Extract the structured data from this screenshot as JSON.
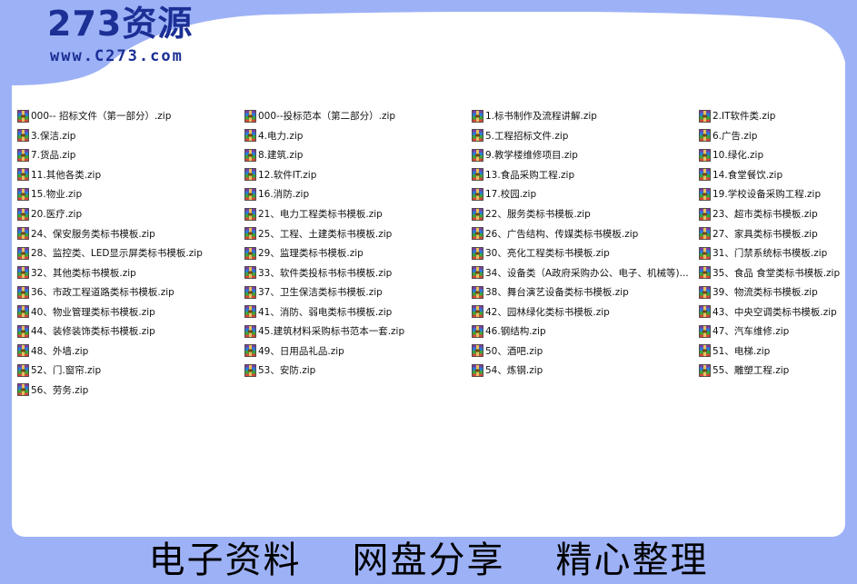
{
  "logo": {
    "title": "273资源",
    "url": "www.C273.com"
  },
  "icon_name": "winrar-archive-icon",
  "colors": {
    "background": "#9db1f6",
    "logo": "#1b2f95",
    "window": "#ffffff"
  },
  "files": [
    {
      "label": "000-- 招标文件（第一部分）.zip"
    },
    {
      "label": "000--投标范本（第二部分）.zip"
    },
    {
      "label": "1.标书制作及流程讲解.zip"
    },
    {
      "label": "2.IT软件类.zip"
    },
    {
      "label": "3.保洁.zip"
    },
    {
      "label": "4.电力.zip"
    },
    {
      "label": "5.工程招标文件.zip"
    },
    {
      "label": "6.广告.zip"
    },
    {
      "label": "7.货品.zip"
    },
    {
      "label": "8.建筑.zip"
    },
    {
      "label": "9.教学楼维修项目.zip"
    },
    {
      "label": "10.绿化.zip"
    },
    {
      "label": "11.其他各类.zip"
    },
    {
      "label": "12.软件IT.zip"
    },
    {
      "label": "13.食品采购工程.zip"
    },
    {
      "label": "14.食堂餐饮.zip"
    },
    {
      "label": "15.物业.zip"
    },
    {
      "label": "16.消防.zip"
    },
    {
      "label": "17.校园.zip"
    },
    {
      "label": "19.学校设备采购工程.zip"
    },
    {
      "label": "20.医疗.zip"
    },
    {
      "label": "21、电力工程类标书模板.zip"
    },
    {
      "label": "22、服务类标书模板.zip"
    },
    {
      "label": "23、超市类标书模板.zip"
    },
    {
      "label": "24、保安服务类标书模板.zip"
    },
    {
      "label": "25、工程、土建类标书模板.zip"
    },
    {
      "label": "26、广告结构、传媒类标书模板.zip"
    },
    {
      "label": "27、家具类标书模板.zip"
    },
    {
      "label": "28、监控类、LED显示屏类标书模板.zip"
    },
    {
      "label": "29、监理类标书模板.zip"
    },
    {
      "label": "30、亮化工程类标书模板.zip"
    },
    {
      "label": "31、门禁系统标书模板.zip"
    },
    {
      "label": "32、其他类标书模板.zip"
    },
    {
      "label": "33、软件类投标书标书模板.zip"
    },
    {
      "label": "34、设备类（A政府采购办公、电子、机械等)..."
    },
    {
      "label": "35、食品 食堂类标书模板.zip"
    },
    {
      "label": "36、市政工程道路类标书模板.zip"
    },
    {
      "label": "37、卫生保洁类标书模板.zip"
    },
    {
      "label": "38、舞台演艺设备类标书模板.zip"
    },
    {
      "label": "39、物流类标书模板.zip"
    },
    {
      "label": "40、物业管理类标书模板.zip"
    },
    {
      "label": "41、消防、弱电类标书模板.zip"
    },
    {
      "label": "42、园林绿化类标书模板.zip"
    },
    {
      "label": "43、中央空调类标书模板.zip"
    },
    {
      "label": "44、装修装饰类标书模板.zip"
    },
    {
      "label": "45.建筑材料采购标书范本一套.zip"
    },
    {
      "label": "46.钢结构.zip"
    },
    {
      "label": "47、汽车维修.zip"
    },
    {
      "label": "48、外墙.zip"
    },
    {
      "label": "49、日用品礼品.zip"
    },
    {
      "label": "50、酒吧.zip"
    },
    {
      "label": "51、电梯.zip"
    },
    {
      "label": "52、门.窗帘.zip"
    },
    {
      "label": "53、安防.zip"
    },
    {
      "label": "54、炼钢.zip"
    },
    {
      "label": "55、雕塑工程.zip"
    },
    {
      "label": "56、劳务.zip"
    }
  ],
  "footer": {
    "items": [
      "电子资料",
      "网盘分享",
      "精心整理"
    ]
  }
}
